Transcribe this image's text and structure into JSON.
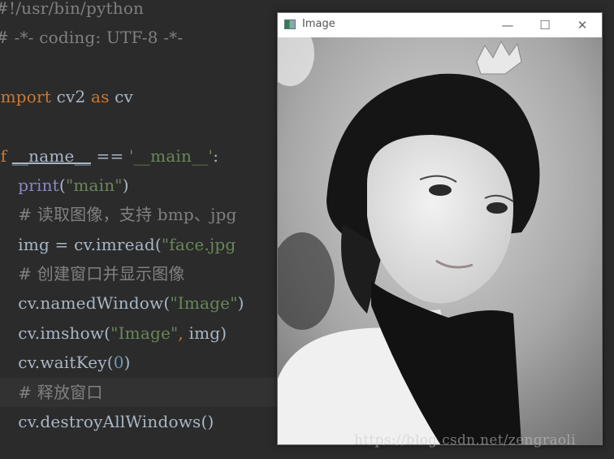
{
  "editor": {
    "lines": [
      {
        "tokens": [
          {
            "t": "#!/usr/bin/python",
            "c": "comment"
          }
        ]
      },
      {
        "tokens": [
          {
            "t": "# -*- coding: UTF-8 -*-",
            "c": "comment"
          }
        ]
      },
      {
        "tokens": []
      },
      {
        "tokens": [
          {
            "t": "import",
            "c": "kw"
          },
          {
            "t": " cv2 ",
            "c": "ident"
          },
          {
            "t": "as",
            "c": "kw"
          },
          {
            "t": " cv",
            "c": "ident"
          }
        ]
      },
      {
        "tokens": []
      },
      {
        "tokens": [
          {
            "t": "if",
            "c": "kw"
          },
          {
            "t": " ",
            "c": "ident"
          },
          {
            "t": "__name__",
            "c": "dunder"
          },
          {
            "t": " == ",
            "c": "ident"
          },
          {
            "t": "'__main__'",
            "c": "str"
          },
          {
            "t": ":",
            "c": "ident"
          }
        ]
      },
      {
        "tokens": [
          {
            "t": "    ",
            "c": "ident"
          },
          {
            "t": "print",
            "c": "builtin"
          },
          {
            "t": "(",
            "c": "ident"
          },
          {
            "t": "\"main\"",
            "c": "str"
          },
          {
            "t": ")",
            "c": "ident"
          }
        ]
      },
      {
        "tokens": [
          {
            "t": "    # 读取图像，支持 bmp、jpg",
            "c": "comment"
          }
        ]
      },
      {
        "tokens": [
          {
            "t": "    img = cv.imread(",
            "c": "ident"
          },
          {
            "t": "\"face.jpg",
            "c": "str"
          }
        ]
      },
      {
        "tokens": [
          {
            "t": "    # 创建窗口并显示图像",
            "c": "comment"
          }
        ]
      },
      {
        "tokens": [
          {
            "t": "    cv.namedWindow(",
            "c": "ident"
          },
          {
            "t": "\"Image\"",
            "c": "str"
          },
          {
            "t": ")",
            "c": "ident"
          }
        ]
      },
      {
        "tokens": [
          {
            "t": "    cv.imshow(",
            "c": "ident"
          },
          {
            "t": "\"Image\"",
            "c": "str"
          },
          {
            "t": ", ",
            "c": "kw"
          },
          {
            "t": "img)",
            "c": "ident"
          }
        ]
      },
      {
        "tokens": [
          {
            "t": "    cv.waitKey(",
            "c": "ident"
          },
          {
            "t": "0",
            "c": "num"
          },
          {
            "t": ")",
            "c": "ident"
          }
        ]
      },
      {
        "tokens": [
          {
            "t": "    # 释放窗口",
            "c": "comment"
          }
        ],
        "highlight": true
      },
      {
        "tokens": [
          {
            "t": "    cv.destroyAllWindows()",
            "c": "ident"
          }
        ]
      }
    ]
  },
  "window": {
    "title": "Image",
    "icon": "app-window-icon",
    "controls": {
      "minimize": "—",
      "maximize": "☐",
      "close": "✕"
    },
    "content": "grayscale portrait photo of a woman wearing a tiara"
  },
  "watermark": "https://blog.csdn.net/zengraoli"
}
